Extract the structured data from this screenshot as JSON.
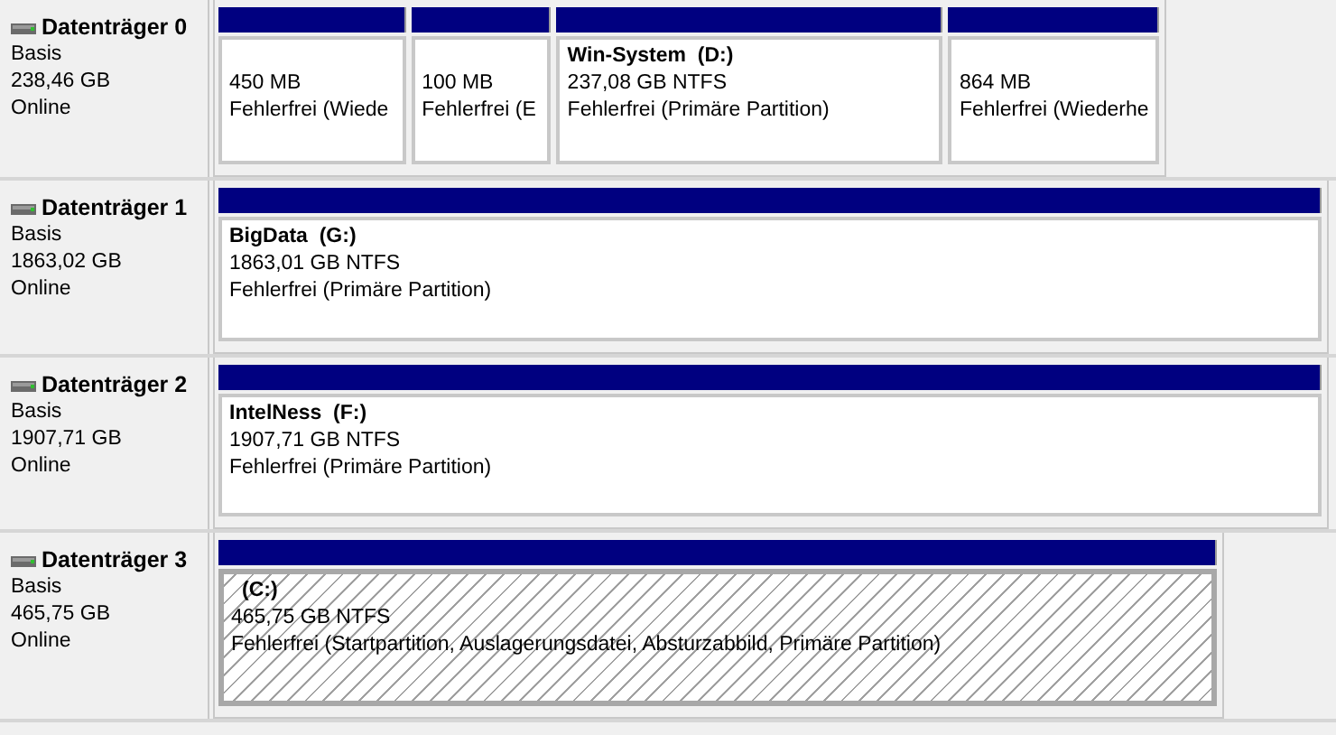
{
  "disks": [
    {
      "name": "Datenträger 0",
      "type": "Basis",
      "size": "238,46 GB",
      "status": "Online",
      "partitions": [
        {
          "size": "450 MB",
          "state": "Fehlerfrei (Wiede",
          "selected": false
        },
        {
          "size": "100 MB",
          "state": "Fehlerfrei (E",
          "selected": false
        },
        {
          "label": "Win-System  (D:)",
          "size": "237,08 GB NTFS",
          "state": "Fehlerfrei (Primäre Partition)",
          "selected": false
        },
        {
          "size": "864 MB",
          "state": "Fehlerfrei (Wiederhe",
          "selected": false
        }
      ]
    },
    {
      "name": "Datenträger 1",
      "type": "Basis",
      "size": "1863,02 GB",
      "status": "Online",
      "partitions": [
        {
          "label": "BigData  (G:)",
          "size": "1863,01 GB NTFS",
          "state": "Fehlerfrei (Primäre Partition)",
          "selected": false
        }
      ]
    },
    {
      "name": "Datenträger 2",
      "type": "Basis",
      "size": "1907,71 GB",
      "status": "Online",
      "partitions": [
        {
          "label": "IntelNess  (F:)",
          "size": "1907,71 GB NTFS",
          "state": "Fehlerfrei (Primäre Partition)",
          "selected": false
        }
      ]
    },
    {
      "name": "Datenträger 3",
      "type": "Basis",
      "size": "465,75 GB",
      "status": "Online",
      "partitions": [
        {
          "label": "(C:)",
          "size": "465,75 GB NTFS",
          "state": "Fehlerfrei (Startpartition, Auslagerungsdatei, Absturzabbild, Primäre Partition)",
          "selected": true
        }
      ]
    }
  ]
}
